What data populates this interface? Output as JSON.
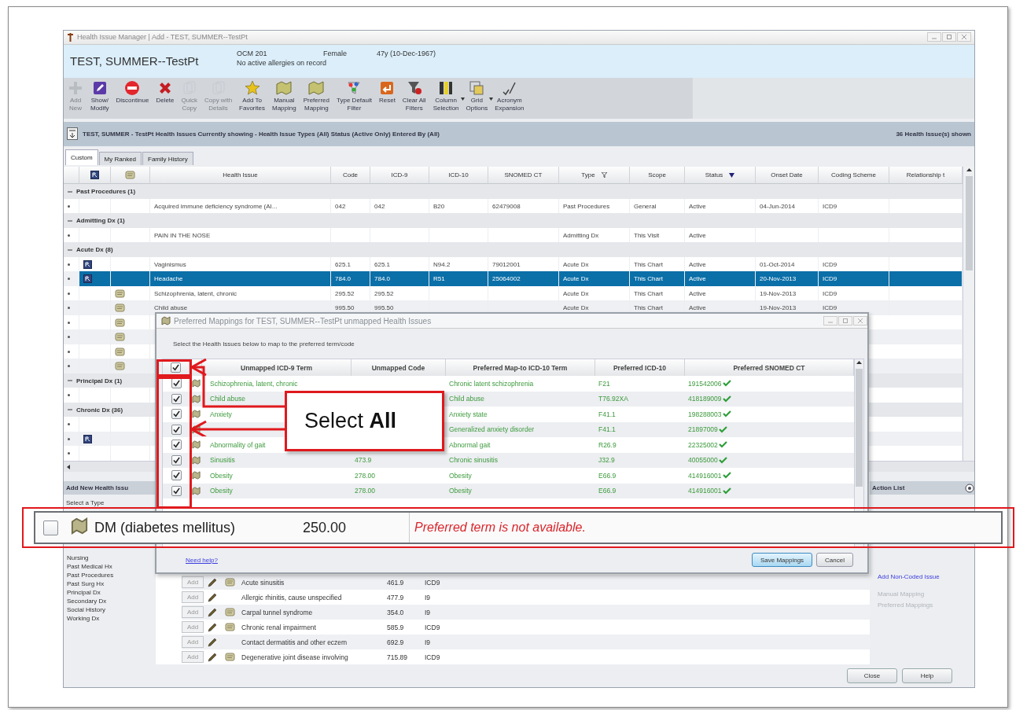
{
  "window": {
    "title": "Health Issue Manager | Add - TEST, SUMMER--TestPt"
  },
  "patient": {
    "name": "TEST, SUMMER--TestPt",
    "id": "OCM 201",
    "sex": "Female",
    "age": "47y (10-Dec-1967)",
    "allergies": "No active allergies on record"
  },
  "toolbar": [
    {
      "kind": "plus",
      "label": "Add\nNew",
      "disabled": true,
      "dropdown": false
    },
    {
      "kind": "edit",
      "label": "Show/\nModify",
      "disabled": false,
      "dropdown": false
    },
    {
      "kind": "stop",
      "label": "Discontinue",
      "disabled": false,
      "dropdown": false
    },
    {
      "kind": "cross",
      "label": "Delete",
      "disabled": false,
      "dropdown": false
    },
    {
      "kind": "copy",
      "label": "Quick\nCopy",
      "disabled": true,
      "dropdown": false
    },
    {
      "kind": "copy",
      "label": "Copy with\nDetails",
      "disabled": true,
      "dropdown": false
    },
    {
      "kind": "star",
      "label": "Add To\nFavorites",
      "disabled": false,
      "dropdown": false
    },
    {
      "kind": "map",
      "label": "Manual\nMapping",
      "disabled": false,
      "dropdown": false
    },
    {
      "kind": "map",
      "label": "Preferred\nMapping",
      "disabled": false,
      "dropdown": false
    },
    {
      "kind": "typefilter",
      "label": "Type Default\nFilter",
      "disabled": false,
      "dropdown": false
    },
    {
      "kind": "reset",
      "label": "Reset",
      "disabled": false,
      "dropdown": false
    },
    {
      "kind": "funnel",
      "label": "Clear All\nFilters",
      "disabled": false,
      "dropdown": false
    },
    {
      "kind": "columns",
      "label": "Column\nSelection",
      "disabled": false,
      "dropdown": true
    },
    {
      "kind": "grid",
      "label": "Grid\nOptions",
      "disabled": false,
      "dropdown": true
    },
    {
      "kind": "pen",
      "label": "Acronym\nExpansion",
      "disabled": false,
      "dropdown": false
    }
  ],
  "info_bar": {
    "text": "TEST, SUMMER - TestPt Health Issues Currently showing - Health Issue Types (All) Status (Active Only) Entered By (All)",
    "count": "36 Health Issue(s) shown"
  },
  "tabs": [
    {
      "label": "Custom",
      "selected": true
    },
    {
      "label": "My Ranked",
      "selected": false
    },
    {
      "label": "Family History",
      "selected": false
    }
  ],
  "grid": {
    "columns": [
      {
        "label": "Health Issue",
        "filter": false,
        "sorted": false
      },
      {
        "label": "Code",
        "filter": false,
        "sorted": false
      },
      {
        "label": "ICD-9",
        "filter": false,
        "sorted": false
      },
      {
        "label": "ICD-10",
        "filter": false,
        "sorted": false
      },
      {
        "label": "SNOMED CT",
        "filter": false,
        "sorted": false
      },
      {
        "label": "Type",
        "filter": true,
        "sorted": false
      },
      {
        "label": "Scope",
        "filter": false,
        "sorted": false
      },
      {
        "label": "Status",
        "filter": false,
        "sorted": true
      },
      {
        "label": "Onset Date",
        "filter": false,
        "sorted": false
      },
      {
        "label": "Coding Scheme",
        "filter": false,
        "sorted": false
      },
      {
        "label": "Relationship t",
        "filter": false,
        "sorted": false
      }
    ],
    "rows": [
      {
        "kind": "group",
        "label": "Past Procedures (1)",
        "expanded": true
      },
      {
        "kind": "plain",
        "selected": false,
        "cells": [
          "Acquired immune deficiency syndrome (AI...",
          "042",
          "042",
          "B20",
          "62479008",
          "Past Procedures",
          "General",
          "Active",
          "04-Jun-2014",
          "ICD9",
          null
        ]
      },
      {
        "kind": "group",
        "label": "Admitting Dx (1)",
        "expanded": true
      },
      {
        "kind": "plain",
        "selected": false,
        "cells": [
          "PAIN IN THE NOSE",
          null,
          null,
          null,
          null,
          "Admitting Dx",
          "This Visit",
          "Active",
          null,
          null,
          null
        ]
      },
      {
        "kind": "group",
        "label": "Acute Dx (8)",
        "expanded": true
      },
      {
        "kind": "record",
        "selected": false,
        "cells": [
          "Vaginismus",
          "625.1",
          "625.1",
          "N94.2",
          "79012001",
          "Acute Dx",
          "This Chart",
          "Active",
          "01-Oct-2014",
          "ICD9",
          null
        ]
      },
      {
        "kind": "record",
        "selected": true,
        "cells": [
          "Headache",
          "784.0",
          "784.0",
          "R51",
          "25064002",
          "Acute Dx",
          "This Chart",
          "Active",
          "20-Nov-2013",
          "ICD9",
          null
        ]
      },
      {
        "kind": "scroll",
        "selected": false,
        "cells": [
          "Schizophrenia, latent, chronic",
          "295.52",
          "295.52",
          null,
          null,
          "Acute Dx",
          "This Chart",
          "Active",
          "19-Nov-2013",
          "ICD9",
          null
        ]
      },
      {
        "kind": "scroll",
        "selected": false,
        "cells": [
          "Child abuse",
          "995.50",
          "995.50",
          null,
          null,
          "Acute Dx",
          "This Chart",
          "Active",
          "19-Nov-2013",
          "ICD9",
          null
        ]
      },
      {
        "kind": "scroll",
        "selected": false
      },
      {
        "kind": "scroll",
        "selected": false
      },
      {
        "kind": "scroll",
        "selected": false
      },
      {
        "kind": "scroll",
        "selected": false
      },
      {
        "kind": "group",
        "label": "Principal Dx (1)",
        "expanded": true
      },
      {
        "kind": "plain",
        "selected": false
      },
      {
        "kind": "group",
        "label": "Chronic Dx (36)",
        "expanded": true
      },
      {
        "kind": "plain",
        "selected": false
      },
      {
        "kind": "record",
        "selected": false
      },
      {
        "kind": "plain",
        "selected": false
      }
    ]
  },
  "add_panel": {
    "title": "Add New Health Issu",
    "prompt": "Select a Type",
    "types": [
      "Nursing",
      "Past Medical Hx",
      "Past Procedures",
      "Past Surg Hx",
      "Principal Dx",
      "Secondary Dx",
      "Social History",
      "Working Dx"
    ]
  },
  "add_list": [
    {
      "button": "Add",
      "kind": "scroll",
      "term": "Acute sinusitis",
      "code": "461.9",
      "scheme": "ICD9"
    },
    {
      "button": "Add",
      "kind": "plain",
      "term": "Allergic rhinitis, cause unspecified",
      "code": "477.9",
      "scheme": "I9"
    },
    {
      "button": "Add",
      "kind": "scroll",
      "term": "Carpal tunnel syndrome",
      "code": "354.0",
      "scheme": "I9"
    },
    {
      "button": "Add",
      "kind": "scroll",
      "term": "Chronic renal impairment",
      "code": "585.9",
      "scheme": "ICD9"
    },
    {
      "button": "Add",
      "kind": "plain",
      "term": "Contact dermatitis and other eczem",
      "code": "692.9",
      "scheme": "I9"
    },
    {
      "button": "Add",
      "kind": "scroll",
      "term": "Degenerative joint disease involving",
      "code": "715.89",
      "scheme": "ICD9"
    }
  ],
  "action_list": {
    "title": "Action List",
    "links": [
      {
        "label": "Add Non-Coded Issue",
        "disabled": false
      },
      {
        "label": "Manual Mapping",
        "disabled": true
      },
      {
        "label": "Preferred Mappings",
        "disabled": true
      }
    ]
  },
  "footer_buttons": [
    "Close",
    "Help"
  ],
  "dialog": {
    "title": "Preferred Mappings for TEST, SUMMER--TestPt unmapped Health Issues",
    "instruction": "Select the Health Issues below to map to the preferred term/code",
    "header_checked": true,
    "columns": [
      "Unmapped ICD-9 Term",
      "Unmapped Code",
      "Preferred Map-to ICD-10 Term",
      "Preferred ICD-10",
      "Preferred SNOMED CT"
    ],
    "rows": [
      {
        "checked": true,
        "mapped": true,
        "cells": [
          "Schizophrenia, latent, chronic",
          null,
          "Chronic latent schizophrenia",
          "F21",
          "191542006"
        ]
      },
      {
        "checked": true,
        "mapped": true,
        "cells": [
          "Child abuse",
          null,
          "Child abuse",
          "T76.92XA",
          "418189009"
        ]
      },
      {
        "checked": true,
        "mapped": true,
        "cells": [
          "Anxiety",
          null,
          "Anxiety state",
          "F41.1",
          "198288003"
        ]
      },
      {
        "checked": true,
        "mapped": true,
        "cells": [
          null,
          null,
          "Generalized anxiety disorder",
          "F41.1",
          "21897009"
        ]
      },
      {
        "checked": true,
        "mapped": true,
        "cells": [
          "Abnormality of gait",
          null,
          "Abnormal gait",
          "R26.9",
          "22325002"
        ]
      },
      {
        "checked": true,
        "mapped": true,
        "cells": [
          "Sinusitis",
          "473.9",
          "Chronic sinusitis",
          "J32.9",
          "40055000"
        ]
      },
      {
        "checked": true,
        "mapped": true,
        "cells": [
          "Obesity",
          "278.00",
          "Obesity",
          "E66.9",
          "414916001"
        ]
      },
      {
        "checked": true,
        "mapped": true,
        "cells": [
          "Obesity",
          "278.00",
          "Obesity",
          "E66.9",
          "414916001"
        ]
      }
    ],
    "help_link": "Need help?",
    "buttons": [
      {
        "label": "Save Mappings",
        "default": true
      },
      {
        "label": "Cancel",
        "default": false
      }
    ]
  },
  "callout": {
    "text": "Select **All**"
  },
  "zoomed_row": {
    "checked": false,
    "term": "DM (diabetes mellitus)",
    "code": "250.00",
    "message": "Preferred term is not available."
  }
}
